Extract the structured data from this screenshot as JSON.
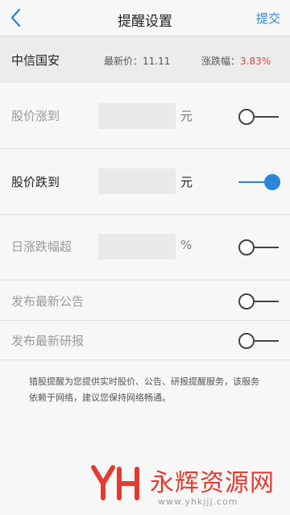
{
  "header": {
    "title": "提醒设置",
    "submit_label": "提交",
    "back_icon": "chevron-left-icon"
  },
  "stock": {
    "name": "中信国安",
    "latest_label": "最新价：",
    "latest_value": "11.11",
    "change_label": "涨跌幅：",
    "change_value": "3.83%"
  },
  "settings": {
    "rise": {
      "label": "股价涨到",
      "value": "",
      "unit": "元",
      "enabled": false
    },
    "fall": {
      "label": "股价跌到",
      "value": "",
      "unit": "元",
      "enabled": true
    },
    "daily": {
      "label": "日涨跌幅超",
      "value": "",
      "unit": "%",
      "enabled": false
    },
    "announcement": {
      "label": "发布最新公告",
      "enabled": false
    },
    "report": {
      "label": "发布最新研报",
      "enabled": false
    }
  },
  "note": "猎股提醒为您提供实时股价、公告、研报提醒服务，该服务依赖于网络，建议您保持网络畅通。",
  "watermark": {
    "text": "永辉资源网",
    "url": "www.yhkjjj.com"
  },
  "colors": {
    "accent": "#2b86d7",
    "rise_red": "#d94a3a",
    "watermark_red": "#e53b2f"
  }
}
